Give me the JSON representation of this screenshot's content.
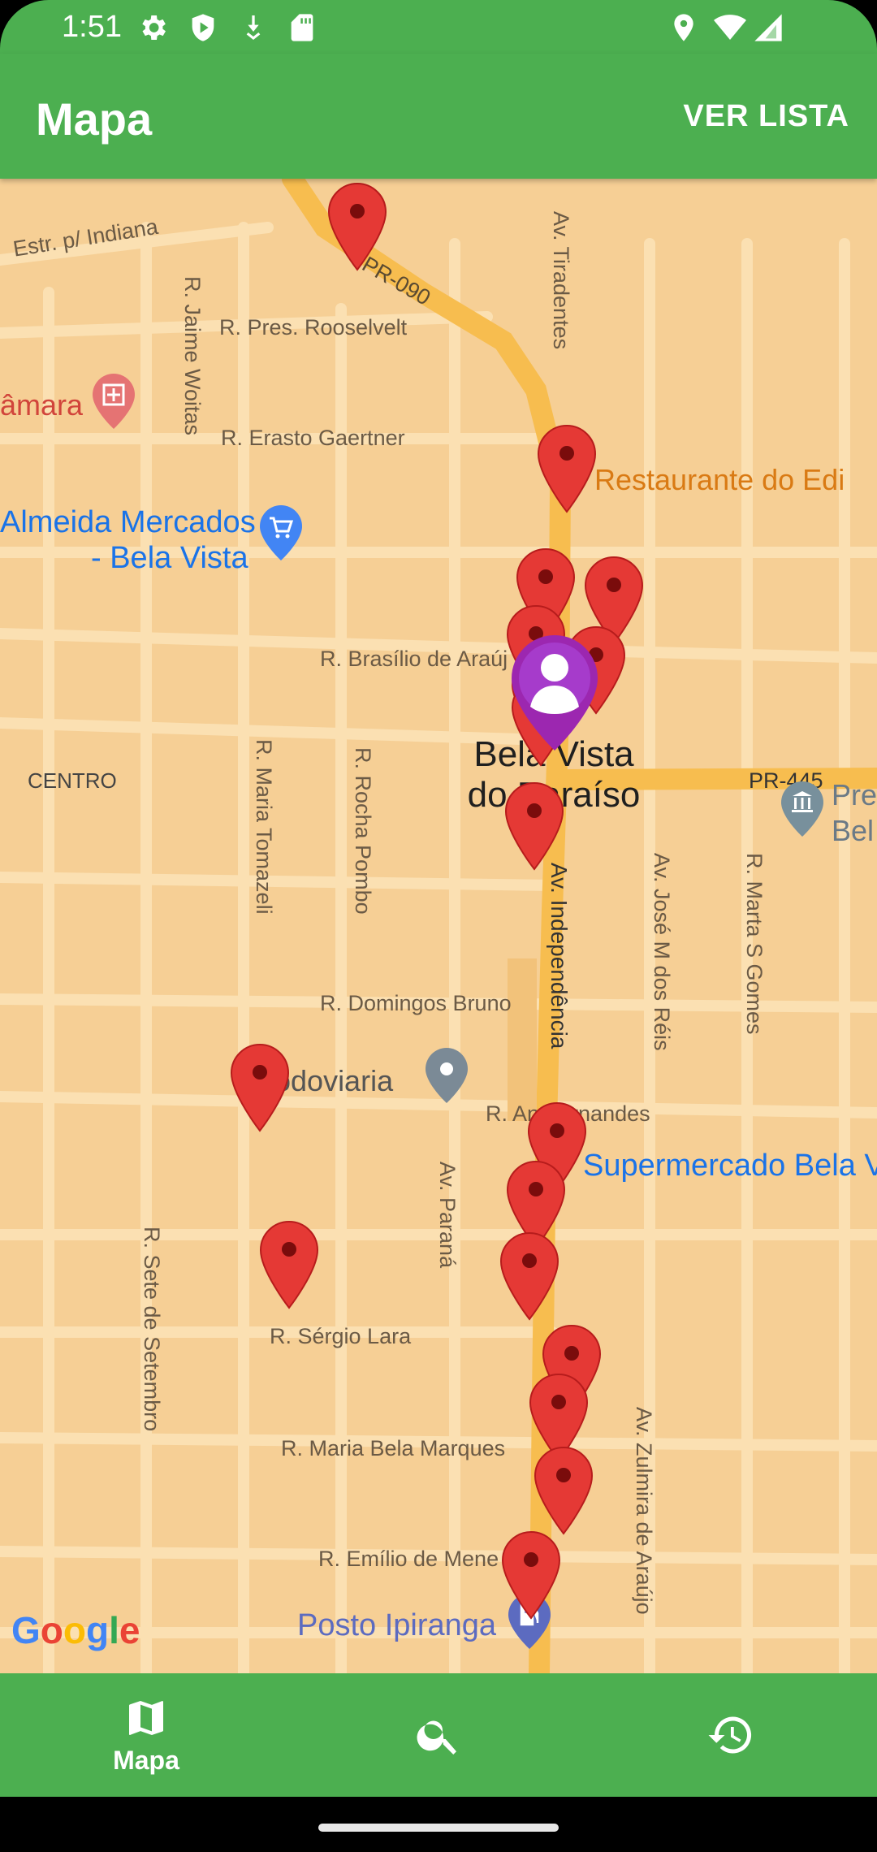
{
  "status_bar": {
    "time": "1:51"
  },
  "app_bar": {
    "title": "Mapa",
    "action_label": "VER LISTA"
  },
  "map": {
    "streets": {
      "estr_indiana": "Estr. p/ Indiana",
      "pr090": "PR-090",
      "av_tiradentes": "Av. Tiradentes",
      "r_pres_roosevelt": "R. Pres. Rooselvelt",
      "r_jaime_woitas": "R. Jaime Woitas",
      "r_erasto_gaertner": "R. Erasto Gaertner",
      "r_brasilio": "R. Brasílio de Araúj",
      "centro": "CENTRO",
      "r_maria_tomazeli": "R. Maria Tomazeli",
      "r_rocha_pombo": "R. Rocha Pombo",
      "pr445": "PR-445",
      "av_independencia": "Av. Independência",
      "av_jose_m_dos_reis": "Av. José M dos Réis",
      "r_marta_s_gomes": "R. Marta S Gomes",
      "r_domingos_bruno": "R. Domingos Bruno",
      "r_fernandes": "R. An    Fernandes",
      "av_parana": "Av. Paraná",
      "r_sete_setembro": "R. Sete de Setembro",
      "r_sergio_lara": "R. Sérgio Lara",
      "r_maria_bela_marques": "R. Maria Bela Marques",
      "av_zulmira": "Av. Zulmira de Araújo",
      "r_emilio": "R. Emílio de Mene"
    },
    "pois": {
      "camara": "âmara",
      "almeida_line1": "Almeida Mercados",
      "almeida_line2": "- Bela Vista",
      "restaurante": "Restaurante do Edi",
      "city_line1": "Bela Vista",
      "city_line2": "do Paraíso",
      "prefeitura_line1": "Pre",
      "prefeitura_line2": "Bel",
      "rodoviaria": "Rodoviaria",
      "supermercado": "Supermercado Bela V",
      "posto": "Posto Ipiranga"
    },
    "marker_count": 20,
    "user_marker": "user-location-icon"
  },
  "google_logo": "Google",
  "bottom_nav": {
    "items": [
      {
        "label": "Mapa",
        "icon": "map-icon",
        "active": true
      },
      {
        "label": "",
        "icon": "search-icon",
        "active": false
      },
      {
        "label": "",
        "icon": "history-icon",
        "active": false
      }
    ]
  },
  "colors": {
    "primary": "#4caf50",
    "map_bg": "#f6cf95",
    "road_major": "#f9c55c",
    "marker": "#e53935",
    "user_marker": "#9c27b0"
  }
}
